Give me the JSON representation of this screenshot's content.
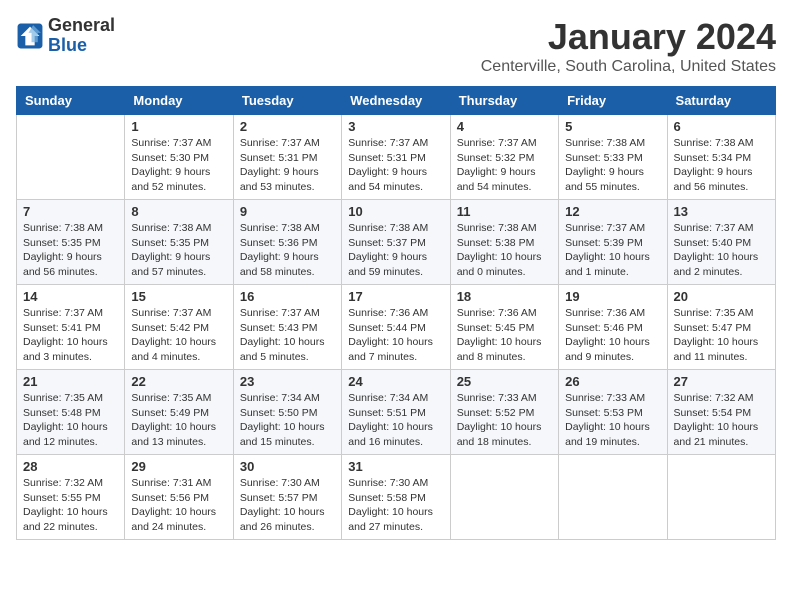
{
  "logo": {
    "text_general": "General",
    "text_blue": "Blue"
  },
  "header": {
    "title": "January 2024",
    "subtitle": "Centerville, South Carolina, United States"
  },
  "weekdays": [
    "Sunday",
    "Monday",
    "Tuesday",
    "Wednesday",
    "Thursday",
    "Friday",
    "Saturday"
  ],
  "weeks": [
    [
      {
        "day": "",
        "sunrise": "",
        "sunset": "",
        "daylight": ""
      },
      {
        "day": "1",
        "sunrise": "Sunrise: 7:37 AM",
        "sunset": "Sunset: 5:30 PM",
        "daylight": "Daylight: 9 hours and 52 minutes."
      },
      {
        "day": "2",
        "sunrise": "Sunrise: 7:37 AM",
        "sunset": "Sunset: 5:31 PM",
        "daylight": "Daylight: 9 hours and 53 minutes."
      },
      {
        "day": "3",
        "sunrise": "Sunrise: 7:37 AM",
        "sunset": "Sunset: 5:31 PM",
        "daylight": "Daylight: 9 hours and 54 minutes."
      },
      {
        "day": "4",
        "sunrise": "Sunrise: 7:37 AM",
        "sunset": "Sunset: 5:32 PM",
        "daylight": "Daylight: 9 hours and 54 minutes."
      },
      {
        "day": "5",
        "sunrise": "Sunrise: 7:38 AM",
        "sunset": "Sunset: 5:33 PM",
        "daylight": "Daylight: 9 hours and 55 minutes."
      },
      {
        "day": "6",
        "sunrise": "Sunrise: 7:38 AM",
        "sunset": "Sunset: 5:34 PM",
        "daylight": "Daylight: 9 hours and 56 minutes."
      }
    ],
    [
      {
        "day": "7",
        "sunrise": "Sunrise: 7:38 AM",
        "sunset": "Sunset: 5:35 PM",
        "daylight": "Daylight: 9 hours and 56 minutes."
      },
      {
        "day": "8",
        "sunrise": "Sunrise: 7:38 AM",
        "sunset": "Sunset: 5:35 PM",
        "daylight": "Daylight: 9 hours and 57 minutes."
      },
      {
        "day": "9",
        "sunrise": "Sunrise: 7:38 AM",
        "sunset": "Sunset: 5:36 PM",
        "daylight": "Daylight: 9 hours and 58 minutes."
      },
      {
        "day": "10",
        "sunrise": "Sunrise: 7:38 AM",
        "sunset": "Sunset: 5:37 PM",
        "daylight": "Daylight: 9 hours and 59 minutes."
      },
      {
        "day": "11",
        "sunrise": "Sunrise: 7:38 AM",
        "sunset": "Sunset: 5:38 PM",
        "daylight": "Daylight: 10 hours and 0 minutes."
      },
      {
        "day": "12",
        "sunrise": "Sunrise: 7:37 AM",
        "sunset": "Sunset: 5:39 PM",
        "daylight": "Daylight: 10 hours and 1 minute."
      },
      {
        "day": "13",
        "sunrise": "Sunrise: 7:37 AM",
        "sunset": "Sunset: 5:40 PM",
        "daylight": "Daylight: 10 hours and 2 minutes."
      }
    ],
    [
      {
        "day": "14",
        "sunrise": "Sunrise: 7:37 AM",
        "sunset": "Sunset: 5:41 PM",
        "daylight": "Daylight: 10 hours and 3 minutes."
      },
      {
        "day": "15",
        "sunrise": "Sunrise: 7:37 AM",
        "sunset": "Sunset: 5:42 PM",
        "daylight": "Daylight: 10 hours and 4 minutes."
      },
      {
        "day": "16",
        "sunrise": "Sunrise: 7:37 AM",
        "sunset": "Sunset: 5:43 PM",
        "daylight": "Daylight: 10 hours and 5 minutes."
      },
      {
        "day": "17",
        "sunrise": "Sunrise: 7:36 AM",
        "sunset": "Sunset: 5:44 PM",
        "daylight": "Daylight: 10 hours and 7 minutes."
      },
      {
        "day": "18",
        "sunrise": "Sunrise: 7:36 AM",
        "sunset": "Sunset: 5:45 PM",
        "daylight": "Daylight: 10 hours and 8 minutes."
      },
      {
        "day": "19",
        "sunrise": "Sunrise: 7:36 AM",
        "sunset": "Sunset: 5:46 PM",
        "daylight": "Daylight: 10 hours and 9 minutes."
      },
      {
        "day": "20",
        "sunrise": "Sunrise: 7:35 AM",
        "sunset": "Sunset: 5:47 PM",
        "daylight": "Daylight: 10 hours and 11 minutes."
      }
    ],
    [
      {
        "day": "21",
        "sunrise": "Sunrise: 7:35 AM",
        "sunset": "Sunset: 5:48 PM",
        "daylight": "Daylight: 10 hours and 12 minutes."
      },
      {
        "day": "22",
        "sunrise": "Sunrise: 7:35 AM",
        "sunset": "Sunset: 5:49 PM",
        "daylight": "Daylight: 10 hours and 13 minutes."
      },
      {
        "day": "23",
        "sunrise": "Sunrise: 7:34 AM",
        "sunset": "Sunset: 5:50 PM",
        "daylight": "Daylight: 10 hours and 15 minutes."
      },
      {
        "day": "24",
        "sunrise": "Sunrise: 7:34 AM",
        "sunset": "Sunset: 5:51 PM",
        "daylight": "Daylight: 10 hours and 16 minutes."
      },
      {
        "day": "25",
        "sunrise": "Sunrise: 7:33 AM",
        "sunset": "Sunset: 5:52 PM",
        "daylight": "Daylight: 10 hours and 18 minutes."
      },
      {
        "day": "26",
        "sunrise": "Sunrise: 7:33 AM",
        "sunset": "Sunset: 5:53 PM",
        "daylight": "Daylight: 10 hours and 19 minutes."
      },
      {
        "day": "27",
        "sunrise": "Sunrise: 7:32 AM",
        "sunset": "Sunset: 5:54 PM",
        "daylight": "Daylight: 10 hours and 21 minutes."
      }
    ],
    [
      {
        "day": "28",
        "sunrise": "Sunrise: 7:32 AM",
        "sunset": "Sunset: 5:55 PM",
        "daylight": "Daylight: 10 hours and 22 minutes."
      },
      {
        "day": "29",
        "sunrise": "Sunrise: 7:31 AM",
        "sunset": "Sunset: 5:56 PM",
        "daylight": "Daylight: 10 hours and 24 minutes."
      },
      {
        "day": "30",
        "sunrise": "Sunrise: 7:30 AM",
        "sunset": "Sunset: 5:57 PM",
        "daylight": "Daylight: 10 hours and 26 minutes."
      },
      {
        "day": "31",
        "sunrise": "Sunrise: 7:30 AM",
        "sunset": "Sunset: 5:58 PM",
        "daylight": "Daylight: 10 hours and 27 minutes."
      },
      {
        "day": "",
        "sunrise": "",
        "sunset": "",
        "daylight": ""
      },
      {
        "day": "",
        "sunrise": "",
        "sunset": "",
        "daylight": ""
      },
      {
        "day": "",
        "sunrise": "",
        "sunset": "",
        "daylight": ""
      }
    ]
  ]
}
